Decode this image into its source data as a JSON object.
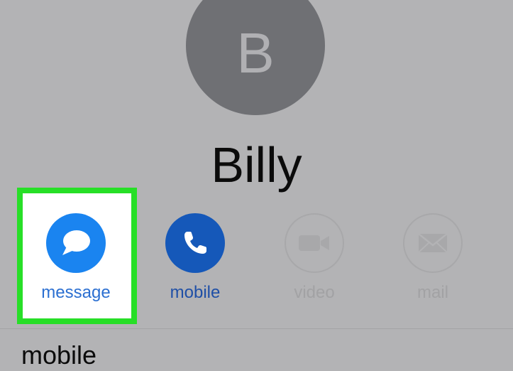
{
  "contact": {
    "initial": "B",
    "name": "Billy"
  },
  "actions": [
    {
      "label": "message",
      "icon": "message-bubble-icon",
      "enabled": true,
      "highlighted": true
    },
    {
      "label": "mobile",
      "icon": "phone-icon",
      "enabled": true,
      "highlighted": false
    },
    {
      "label": "video",
      "icon": "video-camera-icon",
      "enabled": false,
      "highlighted": false
    },
    {
      "label": "mail",
      "icon": "envelope-icon",
      "enabled": false,
      "highlighted": false
    }
  ],
  "section": {
    "label": "mobile"
  },
  "colors": {
    "background": "#b3b3b5",
    "avatar": "#6f7074",
    "message_blue": "#1a84f0",
    "mobile_blue": "#1558b9",
    "disabled_gray": "#a8a8aa",
    "highlight_green": "#27df27"
  }
}
